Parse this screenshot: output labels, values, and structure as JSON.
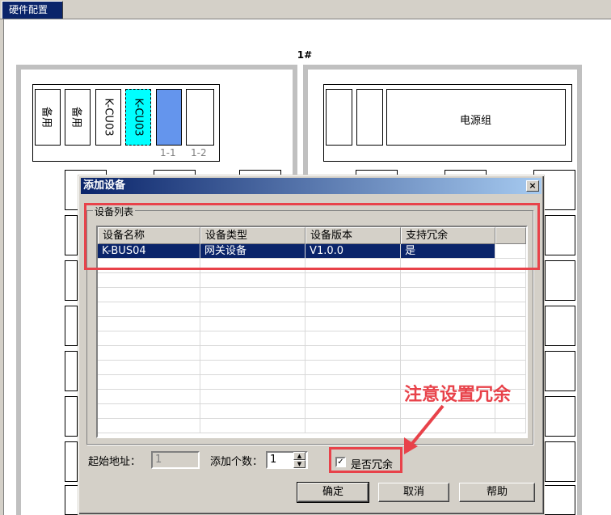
{
  "tab": {
    "label": "硬件配置"
  },
  "rack": {
    "title": "1#",
    "slots": [
      "备用",
      "备用",
      "K-CU03",
      "K-CU03",
      "",
      ""
    ],
    "slot_numbers": [
      "1-1",
      "1-2"
    ],
    "power_label": "电源组"
  },
  "dialog": {
    "title": "添加设备",
    "close": "×",
    "group_label": "设备列表",
    "columns": [
      "设备名称",
      "设备类型",
      "设备版本",
      "支持冗余",
      ""
    ],
    "rows": [
      [
        "K-BUS04",
        "网关设备",
        "V1.0.0",
        "是",
        ""
      ]
    ],
    "start_address_label": "起始地址：",
    "start_address_value": "1",
    "count_label": "添加个数：",
    "count_value": "1",
    "redundant_label": "是否冗余",
    "redundant_checked": true,
    "ok_label": "确定",
    "cancel_label": "取消",
    "help_label": "帮助"
  },
  "annotation": {
    "text": "注意设置冗余",
    "color": "#e8424a"
  }
}
